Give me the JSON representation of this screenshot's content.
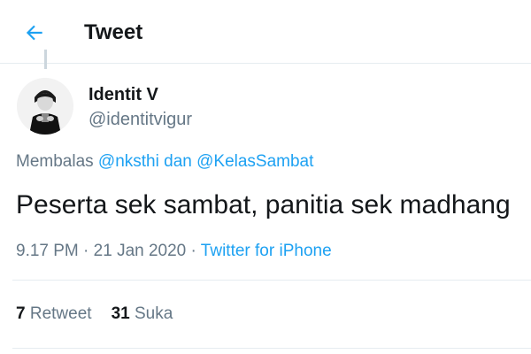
{
  "colors": {
    "accent": "#1da1f2",
    "text_primary": "#14171a",
    "text_secondary": "#657786",
    "divider": "#e6ecf0"
  },
  "header": {
    "back_icon": "arrow-left-icon",
    "title": "Tweet"
  },
  "author": {
    "avatar_icon": "avatar",
    "display_name": "Identit V",
    "handle": "@identitvigur"
  },
  "reply": {
    "prefix": "Membalas ",
    "user1": "@nksthi",
    "connector": " dan ",
    "user2": "@KelasSambat"
  },
  "tweet": {
    "text": "Peserta sek sambat, panitia sek madhang"
  },
  "meta": {
    "time": "9.17 PM",
    "sep1": " · ",
    "date": "21 Jan 2020",
    "sep2": " · ",
    "source": "Twitter for iPhone"
  },
  "stats": {
    "retweets_count": "7",
    "retweets_label": "Retweet",
    "likes_count": "31",
    "likes_label": "Suka"
  }
}
